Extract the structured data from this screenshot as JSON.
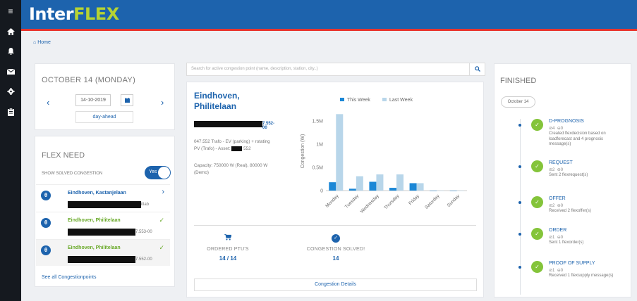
{
  "sidebar": {
    "icons": [
      "menu-icon",
      "home-icon",
      "bell-icon",
      "mail-icon",
      "gear-icon",
      "clipboard-icon"
    ]
  },
  "brand": {
    "part1": "Inter",
    "part2": "FLEX"
  },
  "breadcrumb": {
    "home": "Home"
  },
  "date_card": {
    "title": "OCTOBER 14 (MONDAY)",
    "date_value": "14-10-2019",
    "dayahead": "day-ahead"
  },
  "flex_need": {
    "title": "FLEX NEED",
    "show_solved": "SHOW SOLVED CONGESTION",
    "toggle": "Yes",
    "items": [
      {
        "name": "Eindhoven, Kastanjelaan",
        "suffix": "itlab",
        "status": "open"
      },
      {
        "name": "Eindhoven, Philitelaan",
        "suffix": "7.553-00",
        "status": "solved"
      },
      {
        "name": "Eindhoven, Philitelaan",
        "suffix": "7.552-00",
        "status": "solved"
      }
    ],
    "see_all": "See all Congestionpoints"
  },
  "search": {
    "placeholder": "Search for active congestion point (name, description, station, city..)"
  },
  "congestion_point": {
    "title_line1": "Eindhoven,",
    "title_line2": "Philitelaan",
    "id_suffix": "7.552-00",
    "desc_1": "047.552 Trafo - EV (parking) + rotating",
    "desc_2": "PV (Trafo) - Asset:",
    "desc_3": "552",
    "capacity": "Capacity: 750000 W (Real), 80000 W (Demo)",
    "ordered_label": "ORDERED PTU'S",
    "ordered_value": "14 / 14",
    "solved_label": "CONGESTION SOLVED!",
    "solved_value": "14",
    "details_button": "Congestion Details"
  },
  "chart_data": {
    "type": "bar",
    "categories": [
      "Monday",
      "Tuesday",
      "Wednesday",
      "Thursday",
      "Friday",
      "Saturday",
      "Sunday"
    ],
    "series": [
      {
        "name": "This Week",
        "values": [
          180000,
          40000,
          190000,
          60000,
          160000,
          0,
          0
        ],
        "color": "#1b87d6"
      },
      {
        "name": "Last Week",
        "values": [
          1650000,
          310000,
          350000,
          350000,
          160000,
          0,
          0
        ],
        "color": "#b8d6ea"
      }
    ],
    "ylabel": "Congestion (W)",
    "yticks": [
      "0",
      "0.5M",
      "1M",
      "1.5M"
    ],
    "ylim": [
      0,
      1700000
    ],
    "legend": "top"
  },
  "finished": {
    "title": "FINISHED",
    "date_button": "October 14",
    "steps": [
      {
        "name": "D-PROGNOSIS",
        "ok": "4",
        "err": "0",
        "desc": "Created flexdecision based on loadforecast and 4 prognosis message(s)"
      },
      {
        "name": "REQUEST",
        "ok": "2",
        "err": "0",
        "desc": "Sent 2 flexrequest(s)"
      },
      {
        "name": "OFFER",
        "ok": "2",
        "err": "0",
        "desc": "Received 2 flexoffer(s)"
      },
      {
        "name": "ORDER",
        "ok": "1",
        "err": "0",
        "desc": "Sent 1 flexorder(s)"
      },
      {
        "name": "PROOF OF SUPPLY",
        "ok": "1",
        "err": "0",
        "desc": "Received 1 flexsupply message(s)"
      }
    ]
  }
}
